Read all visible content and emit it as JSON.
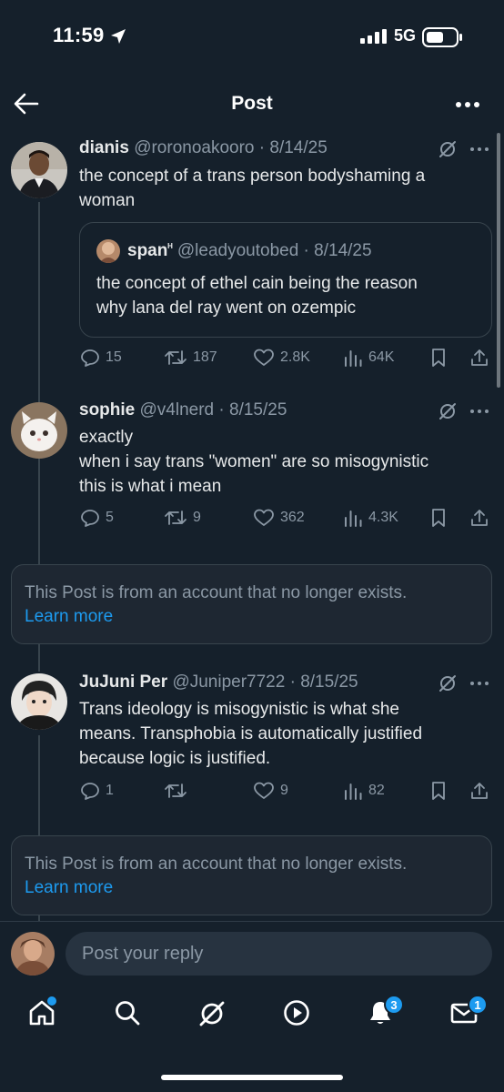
{
  "status_bar": {
    "time": "11:59",
    "network": "5G"
  },
  "header": {
    "title": "Post"
  },
  "posts": [
    {
      "name": "dianis",
      "handle": "@roronoakooro",
      "date": "8/14/25",
      "text_lines": [
        "the concept of a trans person bodyshaming a",
        "woman"
      ],
      "quote": {
        "name": "span",
        "badge": "ᴴ",
        "handle": "@leadyoutobed",
        "date": "8/14/25",
        "text_lines": [
          "the concept of ethel cain being the reason",
          "why lana del ray went on ozempic"
        ]
      },
      "stats": {
        "replies": "15",
        "reposts": "187",
        "likes": "2.8K",
        "views": "64K"
      }
    },
    {
      "name": "sophie",
      "handle": "@v4lnerd",
      "date": "8/15/25",
      "text_lines": [
        "exactly",
        "when i say trans \"women\" are so misogynistic",
        "this is what i mean"
      ],
      "stats": {
        "replies": "5",
        "reposts": "9",
        "likes": "362",
        "views": "4.3K"
      }
    },
    {
      "name": "JuJuni Per",
      "handle": "@Juniper7722",
      "date": "8/15/25",
      "text_lines": [
        "Trans ideology is misogynistic is what she",
        "means. Transphobia is automatically justified",
        "because logic is justified."
      ],
      "stats": {
        "replies": "1",
        "reposts": "",
        "likes": "9",
        "views": "82"
      }
    }
  ],
  "deleted_notice": {
    "text": "This Post is from an account that no longer exists.",
    "link": "Learn more"
  },
  "reply": {
    "placeholder": "Post your reply"
  },
  "nav": {
    "notifications_badge": "3",
    "messages_badge": "1"
  },
  "colors": {
    "background": "#15202b",
    "accent": "#1d9bf0",
    "muted": "#8b98a5",
    "border": "#38444d"
  }
}
